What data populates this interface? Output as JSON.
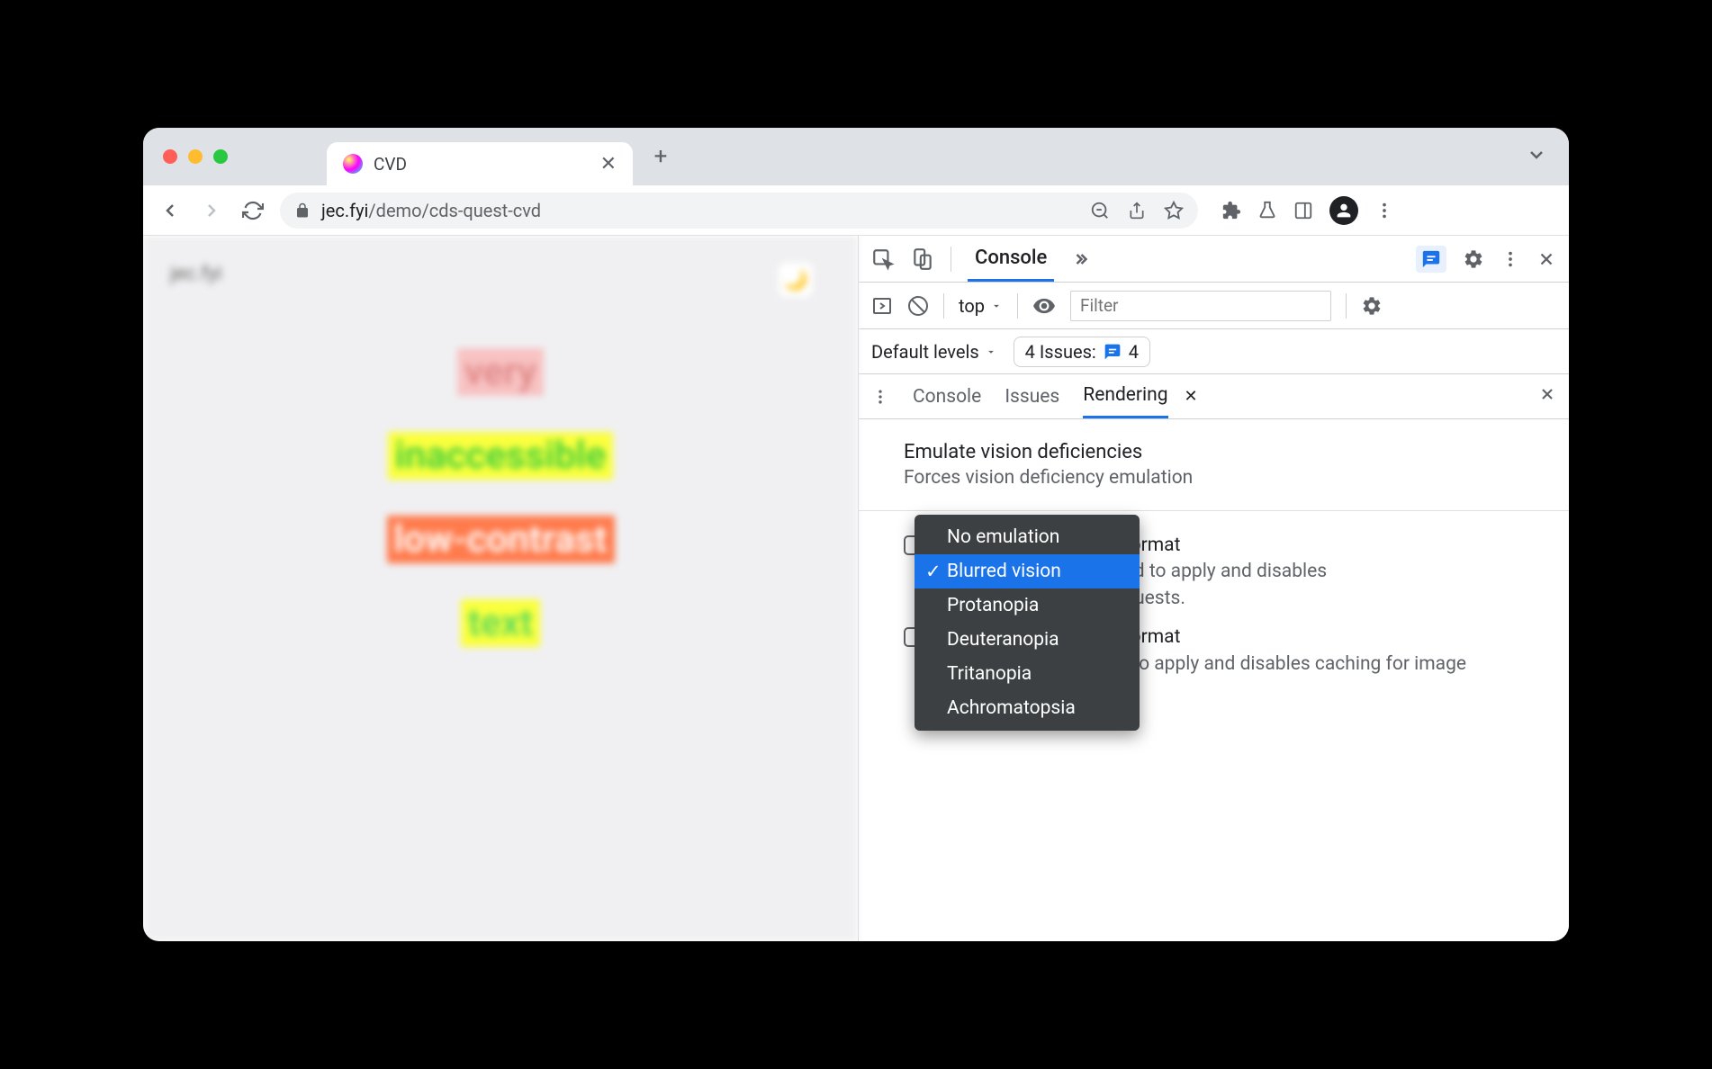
{
  "tab": {
    "title": "CVD"
  },
  "url": {
    "domain": "jec.fyi",
    "path": "/demo/cds-quest-cvd"
  },
  "page": {
    "header": "jec.fyi",
    "words": [
      "very",
      "inaccessible",
      "low-contrast",
      "text"
    ]
  },
  "devtools": {
    "top_tab": "Console",
    "context": "top",
    "filter_placeholder": "Filter",
    "levels": "Default levels",
    "issues_label": "4 Issues:",
    "issues_count": "4",
    "drawer_tabs": [
      "Console",
      "Issues",
      "Rendering"
    ],
    "rendering": {
      "title": "Emulate vision deficiencies",
      "subtitle": "Forces vision deficiency emulation",
      "dropdown": [
        "No emulation",
        "Blurred vision",
        "Protanopia",
        "Deuteranopia",
        "Tritanopia",
        "Achromatopsia"
      ],
      "selected": "Blurred vision",
      "chk1_title_suffix": "format",
      "chk1_desc_a": "ad to apply and disables",
      "chk1_desc_b": "quests.",
      "chk2_title_suffix": "format",
      "chk2_desc": "Requires a page reload to apply and disables caching for image requests."
    }
  }
}
